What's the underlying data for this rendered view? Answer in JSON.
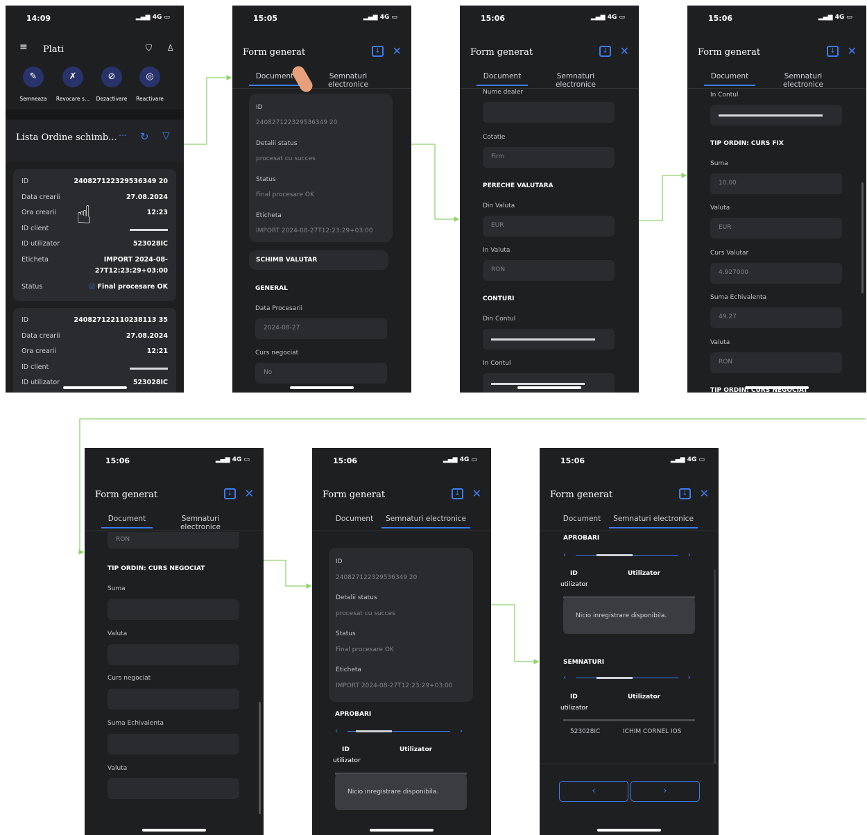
{
  "colors": {
    "accent": "#3d7cf0",
    "bg": "#1e1f21",
    "arrow": "#8fd46a"
  },
  "s1": {
    "time": "14:09",
    "signal": "4G",
    "title": "Plati",
    "icons": [
      {
        "label": "Semneaza",
        "icon": "pen-icon"
      },
      {
        "label": "Revocare s...",
        "icon": "revoke-pen-icon"
      },
      {
        "label": "Dezactivare",
        "icon": "deactivate-icon"
      },
      {
        "label": "Reactivare",
        "icon": "reactivate-icon"
      }
    ],
    "list_title": "Lista Ordine schimb...",
    "card1": [
      [
        "ID",
        "240827122329536349 20"
      ],
      [
        "Data crearii",
        "27.08.2024"
      ],
      [
        "Ora crearii",
        "12:23"
      ],
      [
        "ID client",
        ""
      ],
      [
        "ID utilizator",
        "523028IC"
      ],
      [
        "Eticheta",
        "IMPORT 2024-08-"
      ],
      [
        "",
        "27T12:23:29+03:00"
      ],
      [
        "Status",
        "Final procesare OK"
      ]
    ],
    "card2": [
      [
        "ID",
        "240827122110238113 35"
      ],
      [
        "Data crearii",
        "27.08.2024"
      ],
      [
        "Ora crearii",
        "12:21"
      ],
      [
        "ID client",
        ""
      ],
      [
        "ID utilizator",
        "523028IC"
      ]
    ]
  },
  "form_title": "Form generat",
  "tab_document": "Document",
  "tab_signatures": "Semnaturi electronice",
  "times": {
    "s2": "15:05",
    "s3": "15:06",
    "s4": "15:06",
    "s5": "15:06",
    "s6": "15:06",
    "s7": "15:06"
  },
  "s2": {
    "id_label": "ID",
    "id_value": "240827122329536349 20",
    "status_det_label": "Detalii status",
    "status_det_value": "procesat cu succes",
    "status_label": "Status",
    "status_value": "Final procesare OK",
    "label_label": "Eticheta",
    "label_value": "IMPORT 2024-08-27T12:23:29+03:00",
    "sec_schimb": "SCHIMB VALUTAR",
    "sec_general": "GENERAL",
    "data_proc_label": "Data Procesarii",
    "data_proc_value": "2024-08-27",
    "curs_neg_label": "Curs negociat",
    "curs_neg_value": "No"
  },
  "s3": {
    "dealer_label": "Nume dealer",
    "cotatie_label": "Cotatie",
    "cotatie_value": "Firm",
    "sec_pereche": "PERECHE VALUTARA",
    "din_valuta_label": "Din Valuta",
    "din_valuta_value": "EUR",
    "in_valuta_label": "In Valuta",
    "in_valuta_value": "RON",
    "sec_conturi": "CONTURI",
    "din_cont_label": "Din Contul",
    "din_cont_value": "",
    "in_cont_label": "In Contul",
    "in_cont_value": ""
  },
  "s4": {
    "in_cont_label": "In Contul",
    "in_cont_value": "",
    "sec_fix": "TIP ORDIN: CURS FIX",
    "suma_label": "Suma",
    "suma_value": "10.00",
    "valuta_label": "Valuta",
    "valuta_value": "EUR",
    "curs_label": "Curs Valutar",
    "curs_value": "4.927000",
    "echiv_label": "Suma Echivalenta",
    "echiv_value": "49.27",
    "valuta2_label": "Valuta",
    "valuta2_value": "RON",
    "sec_neg_partial": "TIP ORDIN: CURS NEGOCIAT"
  },
  "s5": {
    "top_value": "RON",
    "sec_neg": "TIP ORDIN: CURS NEGOCIAT",
    "suma_label": "Suma",
    "valuta_label": "Valuta",
    "curs_label": "Curs negociat",
    "echiv_label": "Suma Echivalenta",
    "valuta2_label": "Valuta"
  },
  "s6": {
    "id_label": "ID",
    "id_value": "240827122329536349 20",
    "status_det_label": "Detalii status",
    "status_det_value": "procesat cu succes",
    "status_label": "Status",
    "status_value": "Final procesare OK",
    "label_label": "Eticheta",
    "label_value": "IMPORT 2024-08-27T12:23:29+03:00",
    "sec_aprobari": "APROBARI",
    "col_id": "ID",
    "col_id2": "utilizator",
    "col_user": "Utilizator",
    "no_records": "Nicio inregistrare disponibila."
  },
  "s7": {
    "sec_aprobari": "APROBARI",
    "col_id": "ID",
    "col_id2": "utilizator",
    "col_user": "Utilizator",
    "no_records": "Nicio inregistrare disponibila.",
    "sec_semnaturi": "SEMNATURI",
    "row_id": "523028IC",
    "row_user": "ICHIM CORNEL IOS",
    "prev": "‹",
    "next": "›"
  }
}
